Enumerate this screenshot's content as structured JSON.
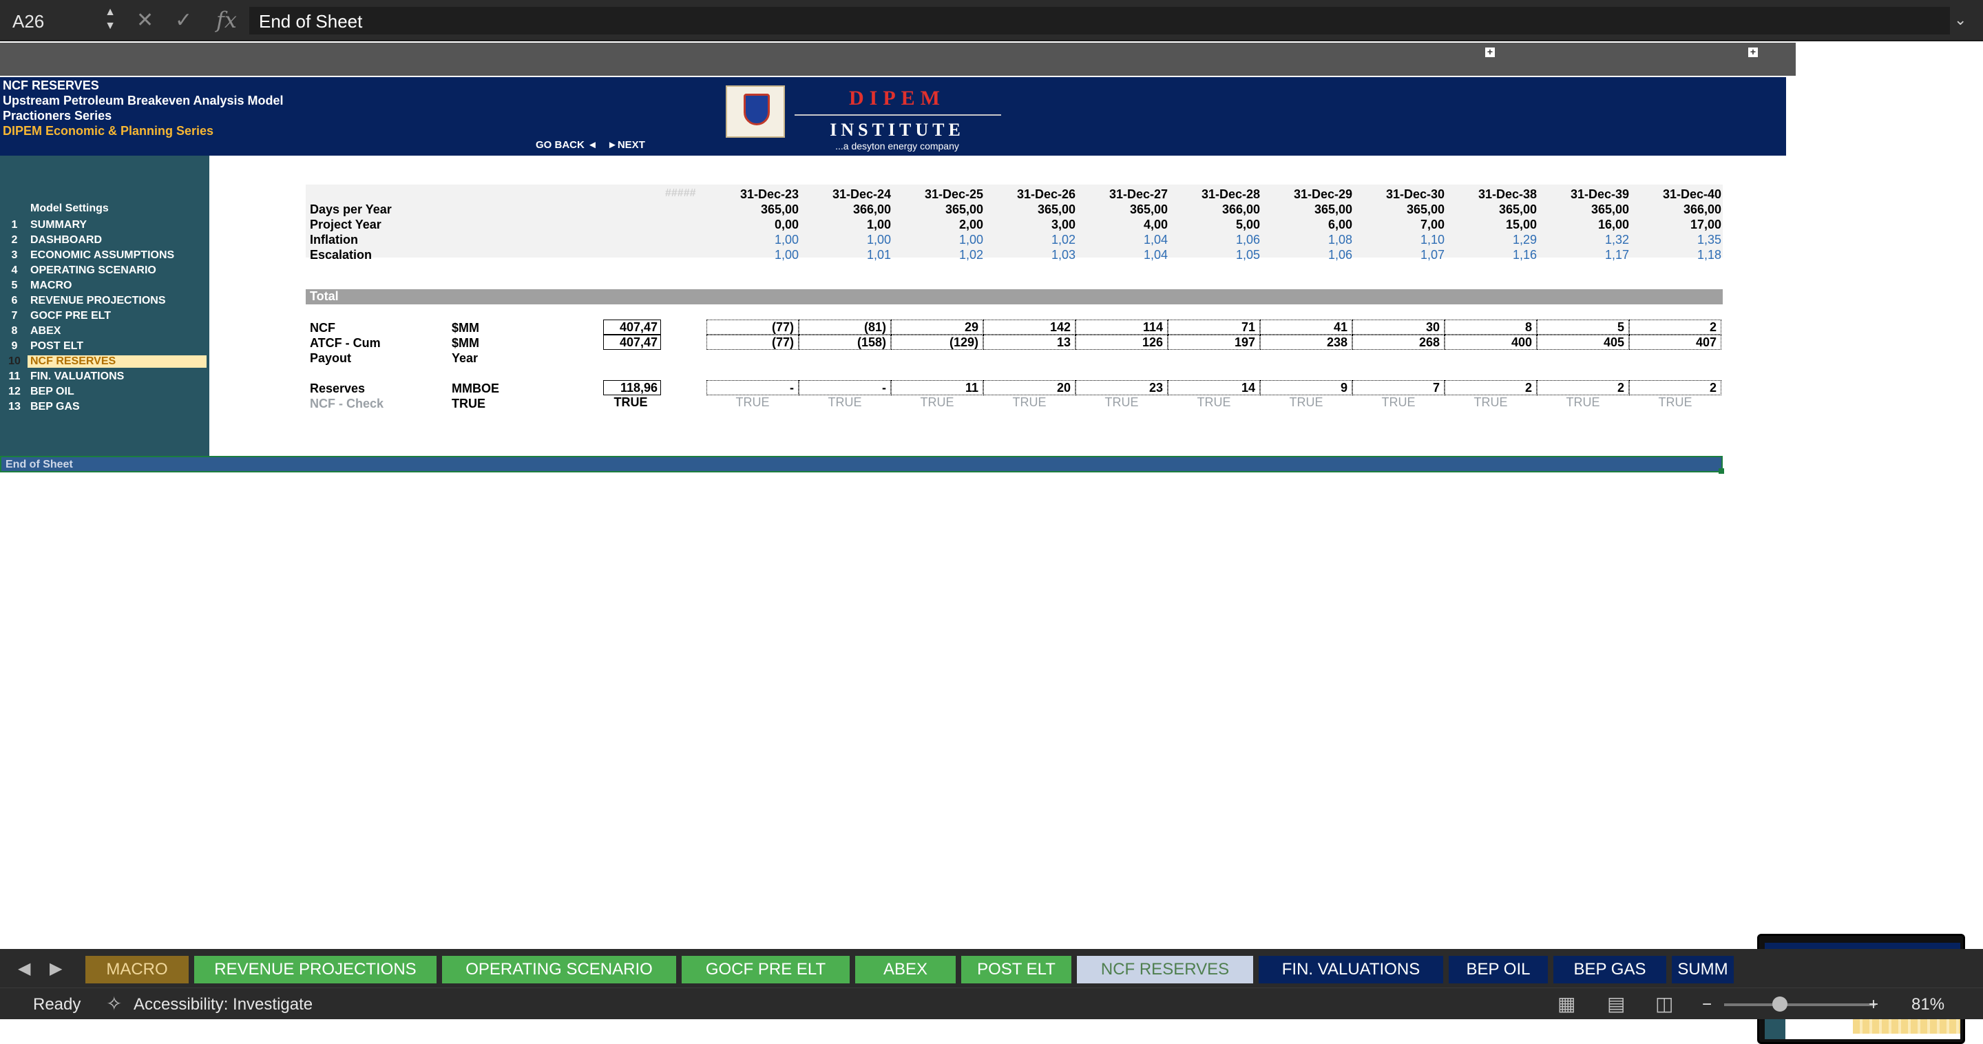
{
  "formula_bar": {
    "cell_ref": "A26",
    "formula": "End of Sheet",
    "fx": "fx",
    "cancel_glyph": "✕",
    "confirm_glyph": "✓",
    "icons": [
      "cancel-icon",
      "confirm-icon",
      "function-icon"
    ]
  },
  "header": {
    "line1": "NCF RESERVES",
    "line2": "Upstream Petroleum Breakeven Analysis Model",
    "line3": "Practioners Series",
    "line4": "DIPEM Economic & Planning Series",
    "go_back": "GO BACK ◄",
    "next": "►NEXT",
    "logo": {
      "title": "DIPEM",
      "subtitle": "INSTITUTE",
      "tagline": "...a desyton energy company"
    }
  },
  "sidebar": {
    "title": "Model Settings",
    "items": [
      {
        "num": "1",
        "label": "SUMMARY"
      },
      {
        "num": "2",
        "label": "DASHBOARD"
      },
      {
        "num": "3",
        "label": "ECONOMIC ASSUMPTIONS"
      },
      {
        "num": "4",
        "label": "OPERATING SCENARIO"
      },
      {
        "num": "5",
        "label": "MACRO"
      },
      {
        "num": "6",
        "label": "REVENUE PROJECTIONS"
      },
      {
        "num": "7",
        "label": "GOCF  PRE ELT"
      },
      {
        "num": "8",
        "label": "ABEX"
      },
      {
        "num": "9",
        "label": "POST ELT"
      },
      {
        "num": "10",
        "label": "NCF RESERVES"
      },
      {
        "num": "11",
        "label": "FIN. VALUATIONS"
      },
      {
        "num": "12",
        "label": "BEP OIL"
      },
      {
        "num": "13",
        "label": "BEP GAS"
      }
    ],
    "active_index": 9
  },
  "table": {
    "hash": "#####",
    "dates": [
      "31-Dec-23",
      "31-Dec-24",
      "31-Dec-25",
      "31-Dec-26",
      "31-Dec-27",
      "31-Dec-28",
      "31-Dec-29",
      "31-Dec-30",
      "31-Dec-38",
      "31-Dec-39",
      "31-Dec-40"
    ],
    "rows": [
      {
        "label": "Days per Year",
        "values": [
          "365,00",
          "366,00",
          "365,00",
          "365,00",
          "365,00",
          "366,00",
          "365,00",
          "365,00",
          "365,00",
          "365,00",
          "366,00"
        ],
        "style": "bold"
      },
      {
        "label": "Project Year",
        "values": [
          "0,00",
          "1,00",
          "2,00",
          "3,00",
          "4,00",
          "5,00",
          "6,00",
          "7,00",
          "15,00",
          "16,00",
          "17,00"
        ],
        "style": "bold"
      },
      {
        "label": "Inflation",
        "values": [
          "1,00",
          "1,00",
          "1,00",
          "1,02",
          "1,04",
          "1,06",
          "1,08",
          "1,10",
          "1,29",
          "1,32",
          "1,35"
        ],
        "style": "blue"
      },
      {
        "label": "Escalation",
        "values": [
          "1,00",
          "1,01",
          "1,02",
          "1,03",
          "1,04",
          "1,05",
          "1,06",
          "1,07",
          "1,16",
          "1,17",
          "1,18"
        ],
        "style": "blue"
      }
    ],
    "total_label": "Total",
    "total_rows": [
      {
        "label": "NCF",
        "unit": "$MM",
        "total": "407,47",
        "values": [
          "(77)",
          "(81)",
          "29",
          "142",
          "114",
          "71",
          "41",
          "30",
          "8",
          "5",
          "2"
        ]
      },
      {
        "label": "ATCF - Cum",
        "unit": "$MM",
        "total": "407,47",
        "values": [
          "(77)",
          "(158)",
          "(129)",
          "13",
          "126",
          "197",
          "238",
          "268",
          "400",
          "405",
          "407"
        ]
      },
      {
        "label": "Payout",
        "unit": "Year",
        "total": "",
        "values": []
      },
      {
        "label": "Reserves",
        "unit": "MMBOE",
        "total": "118,96",
        "values": [
          "-",
          "-",
          "11",
          "20",
          "23",
          "14",
          "9",
          "7",
          "2",
          "2",
          "2"
        ]
      },
      {
        "label": "NCF - Check",
        "unit": "TRUE",
        "total": "TRUE",
        "values": [
          "TRUE",
          "TRUE",
          "TRUE",
          "TRUE",
          "TRUE",
          "TRUE",
          "TRUE",
          "TRUE",
          "TRUE",
          "TRUE",
          "TRUE"
        ]
      }
    ],
    "end_of_sheet": "End of Sheet"
  },
  "tabs": {
    "prev_glyph": "◀",
    "next_glyph": "▶",
    "items": [
      {
        "label": "MACRO",
        "bg": "#8a6a1f",
        "fg": "#f0d79a"
      },
      {
        "label": "REVENUE PROJECTIONS",
        "bg": "#4caf50",
        "fg": "#ffffff"
      },
      {
        "label": "OPERATING SCENARIO",
        "bg": "#4caf50",
        "fg": "#ffffff"
      },
      {
        "label": "GOCF  PRE ELT",
        "bg": "#4caf50",
        "fg": "#ffffff"
      },
      {
        "label": "ABEX",
        "bg": "#4caf50",
        "fg": "#ffffff"
      },
      {
        "label": "POST ELT",
        "bg": "#4caf50",
        "fg": "#ffffff"
      },
      {
        "label": "NCF RESERVES",
        "bg": "#c9d3e6",
        "fg": "#4f7f4f"
      },
      {
        "label": "FIN. VALUATIONS",
        "bg": "#06225e",
        "fg": "#ffffff"
      },
      {
        "label": "BEP OIL",
        "bg": "#06225e",
        "fg": "#ffffff"
      },
      {
        "label": "BEP GAS",
        "bg": "#06225e",
        "fg": "#ffffff"
      },
      {
        "label": "SUMM",
        "bg": "#06225e",
        "fg": "#ffffff"
      }
    ]
  },
  "status": {
    "ready": "Ready",
    "accessibility": "Accessibility: Investigate",
    "zoom_minus": "−",
    "zoom_plus": "+",
    "zoom": "81%"
  },
  "colors": {
    "header_navy": "#06225e",
    "sidebar_teal": "#285562",
    "link_blue": "#2e6db4",
    "active_yellow": "#ffeab0"
  }
}
